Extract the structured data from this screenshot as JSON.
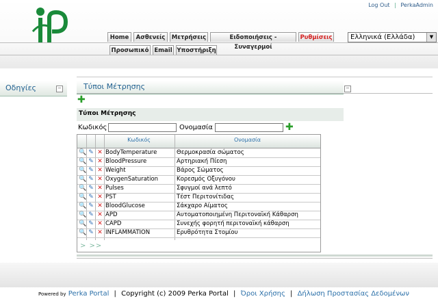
{
  "header": {
    "top_links": {
      "logout": "Log Out",
      "user": "PerkaAdmin"
    },
    "tabs_row1": [
      {
        "label": "Home",
        "active": false
      },
      {
        "label": "Ασθενείς",
        "active": false
      },
      {
        "label": "Μετρήσεις",
        "active": false
      },
      {
        "label": "Ειδοποιήσεις - Συναγερμοί",
        "active": false
      },
      {
        "label": "Ρυθμίσεις",
        "active": true
      }
    ],
    "tabs_row2": [
      {
        "label": "Προσωπικό"
      },
      {
        "label": "Email"
      },
      {
        "label": "Υποστήριξη"
      }
    ],
    "language": {
      "selected": "Ελληνικά (Ελλάδα)"
    }
  },
  "left_panel": {
    "title": "Οδηγίες"
  },
  "content": {
    "title": "Τύποι Μέτρησης",
    "filter": {
      "title": "Τύποι Μέτρησης",
      "code_label": "Κωδικός",
      "code_value": "",
      "name_label": "Ονομασία",
      "name_value": ""
    },
    "table": {
      "columns": [
        "Κωδικός",
        "Ονομασία"
      ],
      "rows": [
        {
          "code": "BodyTemperature",
          "name": "Θερμοκρασία σώματος"
        },
        {
          "code": "BloodPressure",
          "name": "Αρτηριακή Πίεση"
        },
        {
          "code": "Weight",
          "name": "Βάρος Σώματος"
        },
        {
          "code": "OxygenSaturation",
          "name": "Κορεσμός Οξυγόνου"
        },
        {
          "code": "Pulses",
          "name": "Σφυγμοί ανά λεπτό"
        },
        {
          "code": "PST",
          "name": "Τέστ Περιτονίτιδας"
        },
        {
          "code": "BloodGlucose",
          "name": "Σάκχαρο Αίματος"
        },
        {
          "code": "APD",
          "name": "Αυτοματοποιημένη Περιτοναϊκή Κάθαρση"
        },
        {
          "code": "CAPD",
          "name": "Συνεχής φορητή περιτοναϊκή κάθαρση"
        },
        {
          "code": "INFLAMMATION",
          "name": "Ερυθρότητα Στομίου"
        }
      ],
      "pager": "> >>"
    }
  },
  "footer": {
    "powered_by": "Powered by",
    "brand": "Perka Portal",
    "copyright": "Copyright (c) 2009 Perka Portal",
    "terms": "Όροι Χρήσης",
    "privacy": "Δήλωση Προστασίας Δεδομένων"
  },
  "icons": {
    "view": "magnifier-icon",
    "edit": "pencil-icon",
    "delete": "red-x-icon",
    "add": "green-plus-icon"
  },
  "colors": {
    "active_tab": "#d42020",
    "link": "#2a6fa8",
    "panel_title": "#1f5f8f",
    "add_icon": "#2a9d2a",
    "delete_icon": "#d61a1a"
  }
}
